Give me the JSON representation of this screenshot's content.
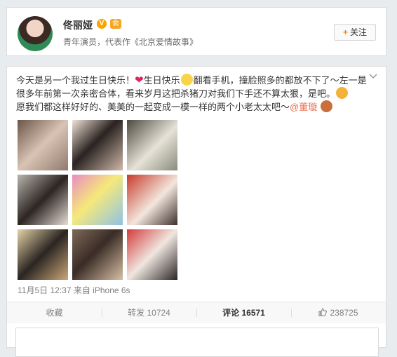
{
  "profile": {
    "name": "佟丽娅",
    "verified_badge": "V",
    "vip_badge": "会",
    "description": "青年演员，代表作《北京爱情故事》",
    "follow_label": "关注",
    "follow_plus": "+"
  },
  "post": {
    "text_parts": {
      "p1": "今天是另一个我过生日快乐！",
      "p2": "生日快乐",
      "p3": "翻看手机，撞脸照多的都放不下了～左一是很多年前第一次亲密合体，看来岁月这把杀猪刀对我们下手还不算太狠，是吧。",
      "p4": "愿我们都这样好好的、美美的一起变成一模一样的两个小老太太吧～",
      "mention": "@董璇"
    },
    "timestamp": "11月5日 12:37",
    "source": "来自 iPhone 6s"
  },
  "actions": {
    "favorite": "收藏",
    "repost": "转发 10724",
    "comment_label": "评论",
    "comment_count": "16571",
    "like_count": "238725"
  },
  "colors": {
    "accent_orange": "#ff8200",
    "mention": "#eb7350",
    "verified": "#f7a600"
  }
}
